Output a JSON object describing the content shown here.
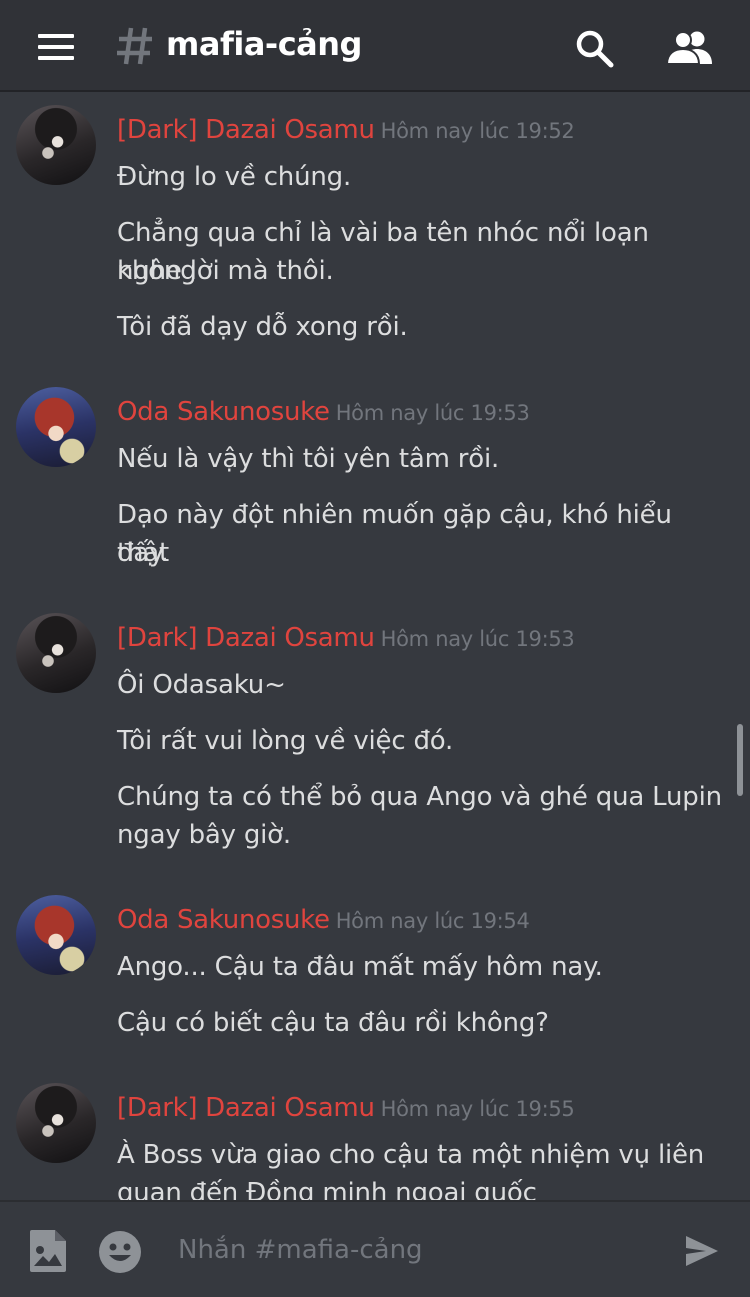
{
  "header": {
    "channel_name": "mafia-cảng",
    "icons": {
      "menu": "hamburger-menu-icon",
      "hash": "hash-icon",
      "search": "search-icon",
      "members": "members-icon"
    }
  },
  "colors": {
    "author": "#e0443e",
    "background": "#36393f",
    "header_bg": "#303237"
  },
  "messages": [
    {
      "author": "[Dark] Dazai Osamu",
      "timestamp": "Hôm nay lúc 19:52",
      "lines": [
        "Đừng lo về chúng.",
        "Chẳng qua chỉ là vài ba tên nhóc nổi loạn không",
        "nghe lời mà thôi.",
        "Tôi đã dạy dỗ xong rồi."
      ]
    },
    {
      "author": "Oda Sakunosuke",
      "timestamp": "Hôm nay lúc 19:53",
      "lines": [
        "Nếu là vậy thì tôi yên tâm rồi.",
        "Dạo này đột nhiên muốn gặp cậu, khó hiểu thật",
        "đấy."
      ]
    },
    {
      "author": "[Dark] Dazai Osamu",
      "timestamp": "Hôm nay lúc 19:53",
      "lines": [
        "Ôi Odasaku~",
        "Tôi rất vui lòng về việc đó.",
        "Chúng ta có thể bỏ qua Ango và ghé qua Lupin",
        "ngay bây giờ."
      ]
    },
    {
      "author": "Oda Sakunosuke",
      "timestamp": "Hôm nay lúc 19:54",
      "lines": [
        "Ango... Cậu ta đâu mất mấy hôm nay.",
        "Cậu có biết cậu ta đâu rồi không?"
      ]
    },
    {
      "author": "[Dark] Dazai Osamu",
      "timestamp": "Hôm nay lúc 19:55",
      "lines": [
        "À Boss vừa giao cho cậu ta một nhiệm vụ liên",
        "quan đến Đồng minh ngoại quốc"
      ]
    }
  ],
  "composer": {
    "placeholder": "Nhắn #mafia-cảng",
    "value": "",
    "icons": {
      "image": "image-upload-icon",
      "emoji": "emoji-icon",
      "send": "send-icon"
    }
  }
}
